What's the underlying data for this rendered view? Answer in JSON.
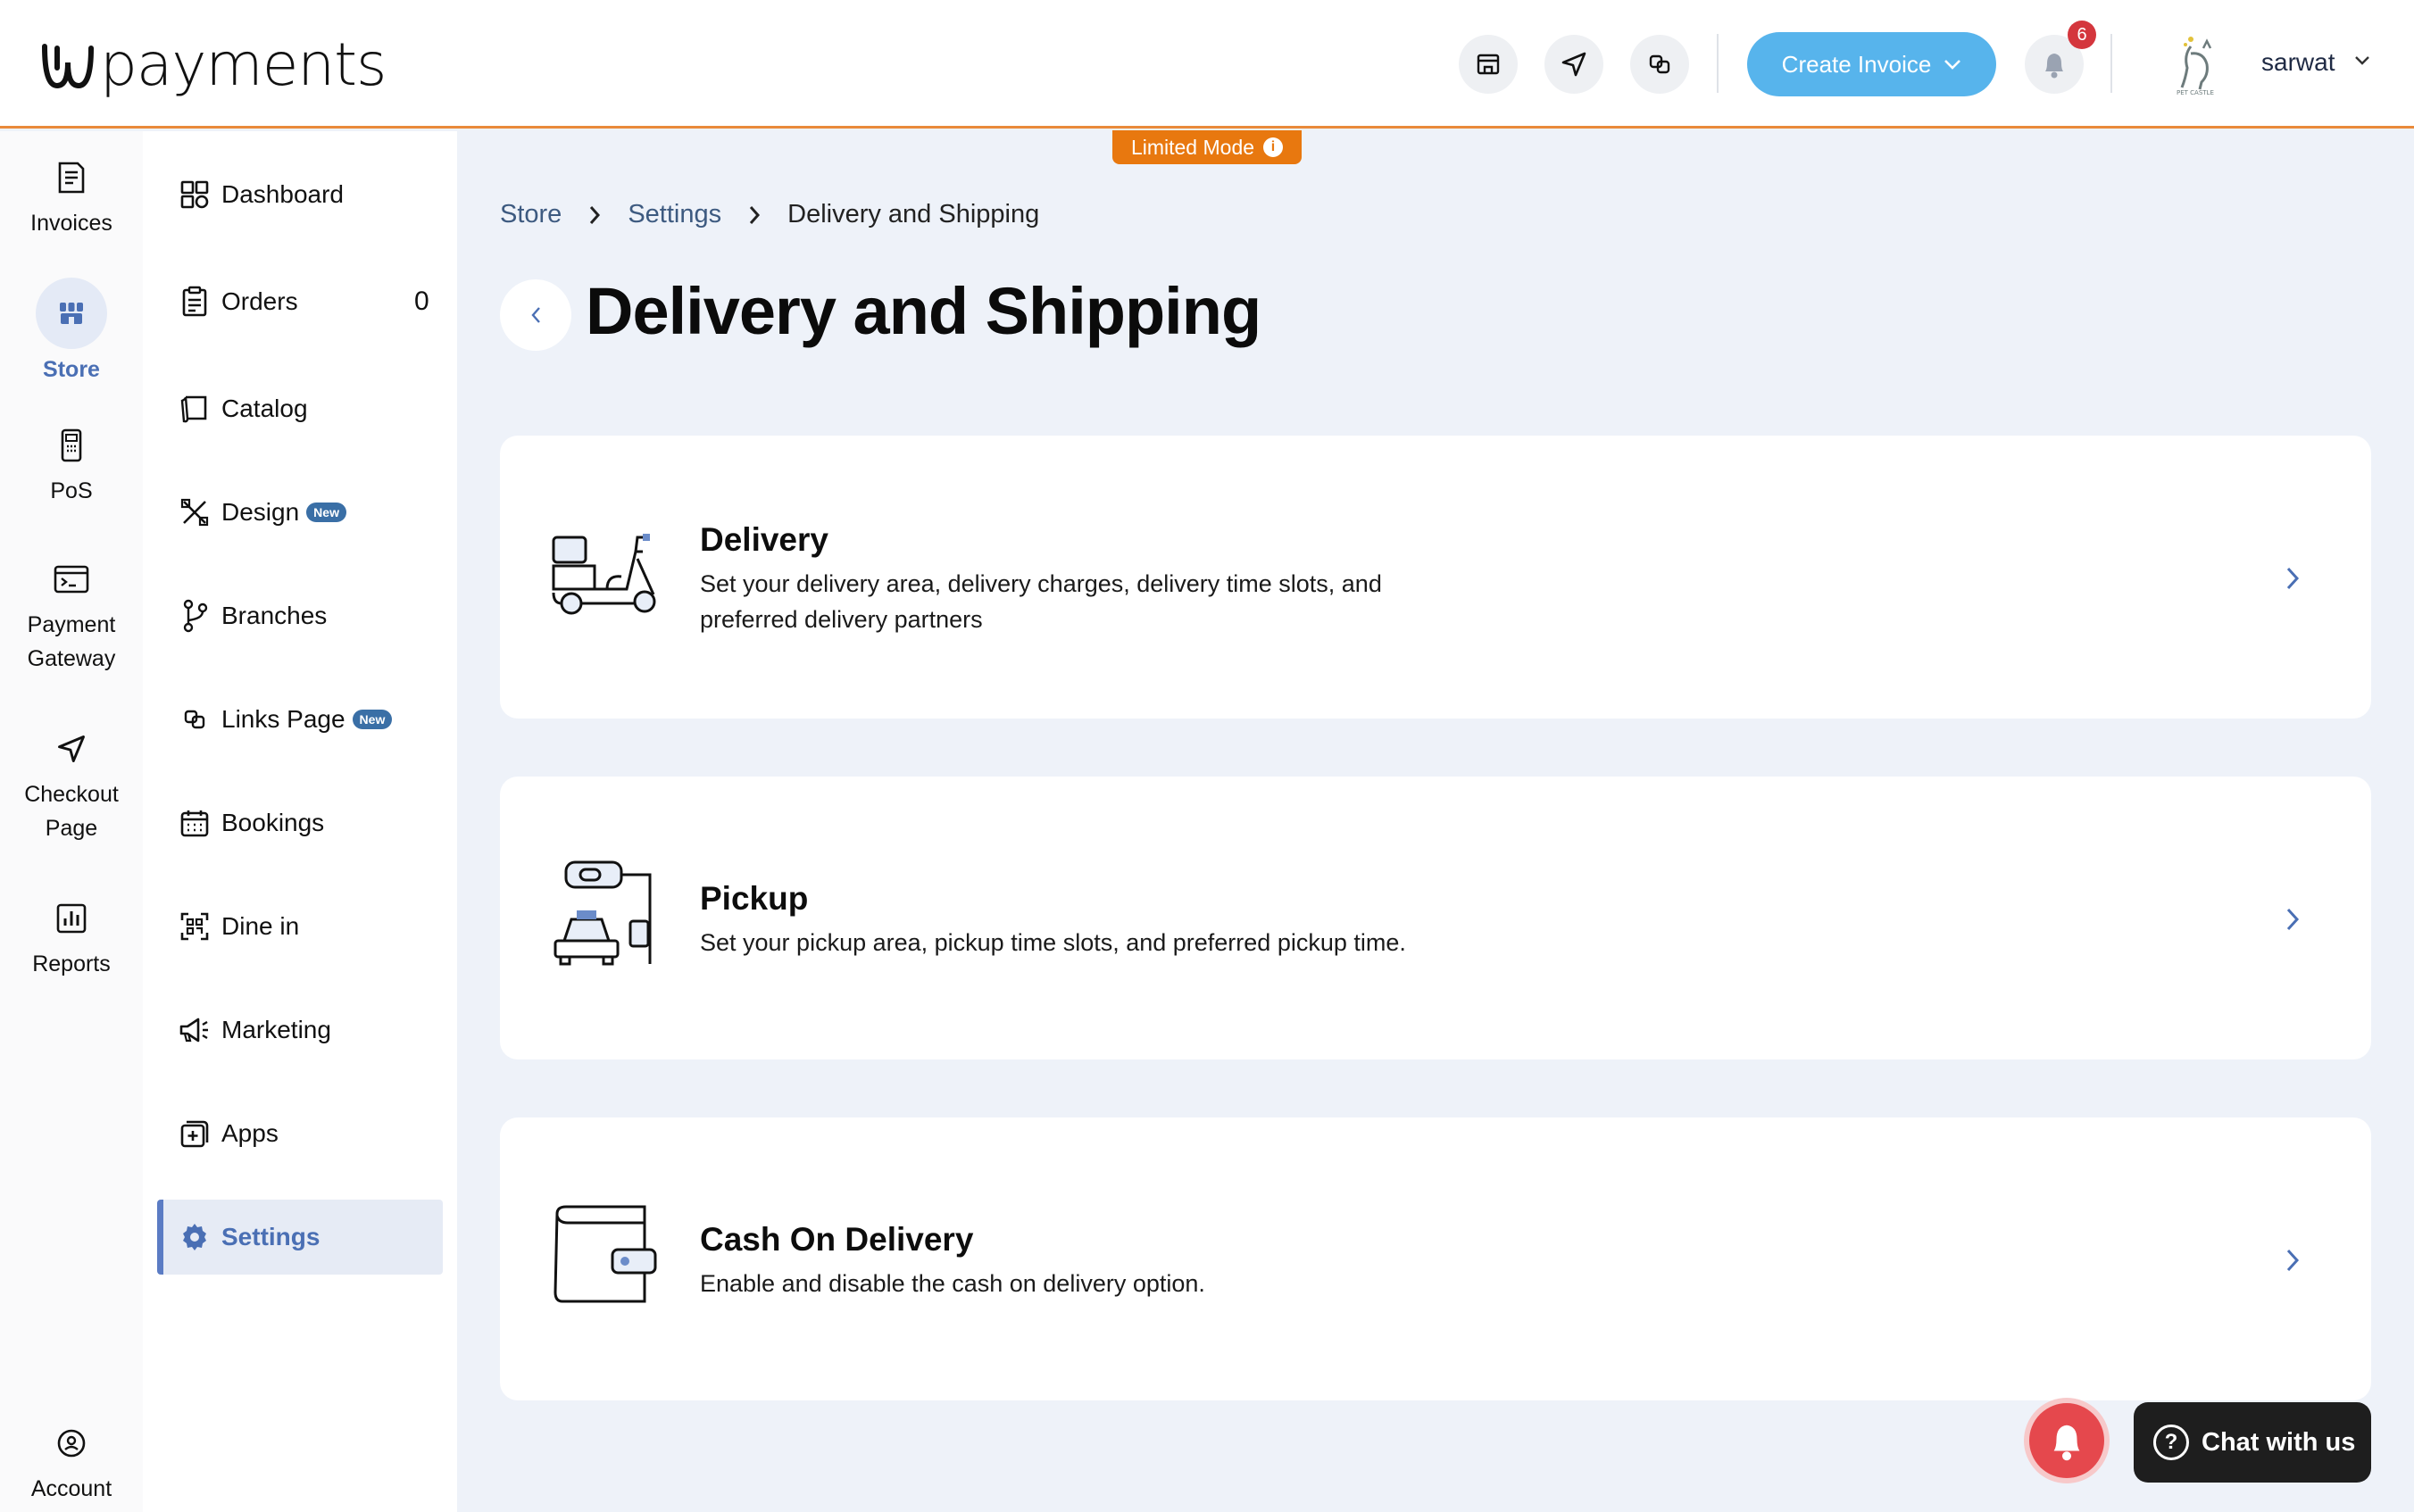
{
  "app": {
    "brand": "payments"
  },
  "header": {
    "create_invoice_label": "Create Invoice",
    "notification_count": "6",
    "user_name": "sarwat",
    "limited_mode_label": "Limited Mode",
    "icons": [
      "store-icon",
      "send-icon",
      "links-icon",
      "bell-icon"
    ]
  },
  "rail": {
    "items": [
      {
        "label": "Invoices",
        "icon": "invoice-icon"
      },
      {
        "label": "Store",
        "icon": "store-icon",
        "active": true
      },
      {
        "label": "PoS",
        "icon": "pos-icon"
      },
      {
        "label": "Payment Gateway",
        "icon": "terminal-icon"
      },
      {
        "label": "Checkout Page",
        "icon": "send-icon"
      },
      {
        "label": "Reports",
        "icon": "chart-icon"
      },
      {
        "label": "Account",
        "icon": "account-icon"
      }
    ]
  },
  "sidebar": {
    "items": [
      {
        "label": "Dashboard",
        "icon": "grid-icon"
      },
      {
        "label": "Orders",
        "icon": "clipboard-icon",
        "count": "0"
      },
      {
        "label": "Catalog",
        "icon": "catalog-icon"
      },
      {
        "label": "Design",
        "icon": "design-icon",
        "badge": "New"
      },
      {
        "label": "Branches",
        "icon": "branch-icon"
      },
      {
        "label": "Links Page",
        "icon": "links-icon",
        "badge": "New"
      },
      {
        "label": "Bookings",
        "icon": "calendar-icon"
      },
      {
        "label": "Dine in",
        "icon": "qr-icon"
      },
      {
        "label": "Marketing",
        "icon": "megaphone-icon"
      },
      {
        "label": "Apps",
        "icon": "apps-icon"
      },
      {
        "label": "Settings",
        "icon": "gear-icon",
        "active": true
      }
    ]
  },
  "breadcrumb": [
    "Store",
    "Settings",
    "Delivery and Shipping"
  ],
  "page": {
    "title": "Delivery and Shipping",
    "cards": [
      {
        "title": "Delivery",
        "description": "Set your delivery area, delivery charges, delivery time slots, and preferred delivery partners",
        "icon": "scooter-icon"
      },
      {
        "title": "Pickup",
        "description": "Set your pickup area, pickup time slots, and preferred pickup time.",
        "icon": "pickup-car-icon"
      },
      {
        "title": "Cash On Delivery",
        "description": "Enable and disable the cash on delivery option.",
        "icon": "wallet-icon"
      }
    ]
  },
  "chat": {
    "label": "Chat with us"
  },
  "colors": {
    "accent": "#57b4ec",
    "active": "#4a6fb4",
    "limited": "#e8780f",
    "badge": "#d4363d"
  }
}
